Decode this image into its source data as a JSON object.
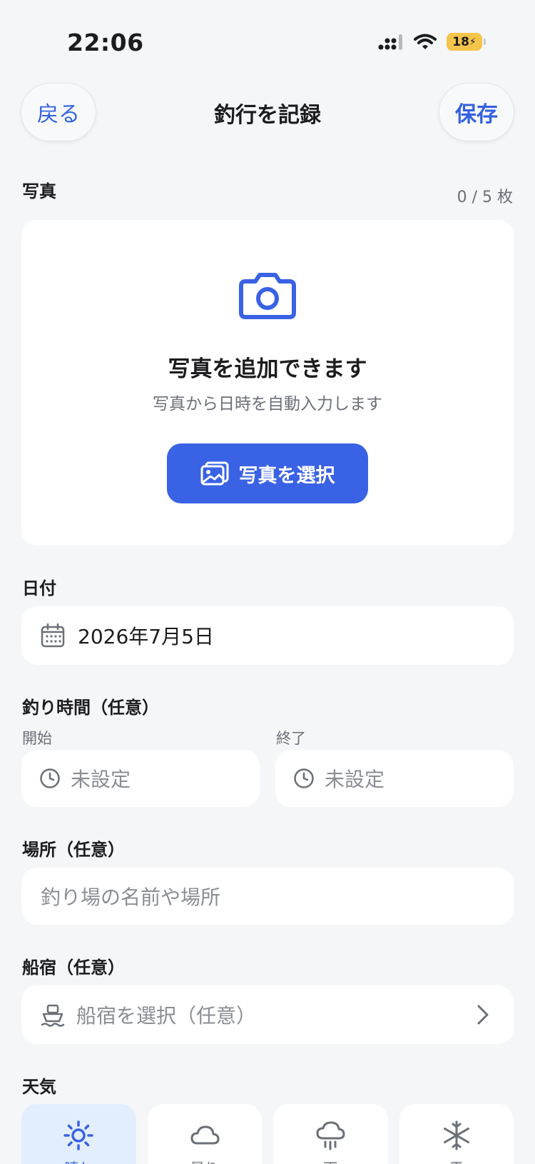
{
  "status_bar": {
    "time": "22:06",
    "battery": "18"
  },
  "nav": {
    "back_label": "戻る",
    "title": "釣行を記録",
    "save_label": "保存"
  },
  "photos": {
    "label": "写真",
    "counter": "0 / 5 枚",
    "title": "写真を追加できます",
    "subtitle": "写真から日時を自動入力します",
    "button_label": "写真を選択"
  },
  "date": {
    "label": "日付",
    "value": "2026年7月5日"
  },
  "fishing_time": {
    "label": "釣り時間（任意）",
    "start_label": "開始",
    "start_value": "未設定",
    "end_label": "終了",
    "end_value": "未設定"
  },
  "place": {
    "label": "場所（任意）",
    "placeholder": "釣り場の名前や場所"
  },
  "boat": {
    "label": "船宿（任意）",
    "placeholder": "船宿を選択（任意）"
  },
  "weather": {
    "label": "天気",
    "options": [
      {
        "label": "晴れ",
        "icon": "sun-icon",
        "selected": true
      },
      {
        "label": "曇り",
        "icon": "cloud-icon",
        "selected": false
      },
      {
        "label": "雨",
        "icon": "rain-icon",
        "selected": false
      },
      {
        "label": "雪",
        "icon": "snow-icon",
        "selected": false
      }
    ]
  },
  "colors": {
    "accent": "#3a62e4",
    "selected_bg": "#e3eefc",
    "battery": "#f5c44a"
  }
}
